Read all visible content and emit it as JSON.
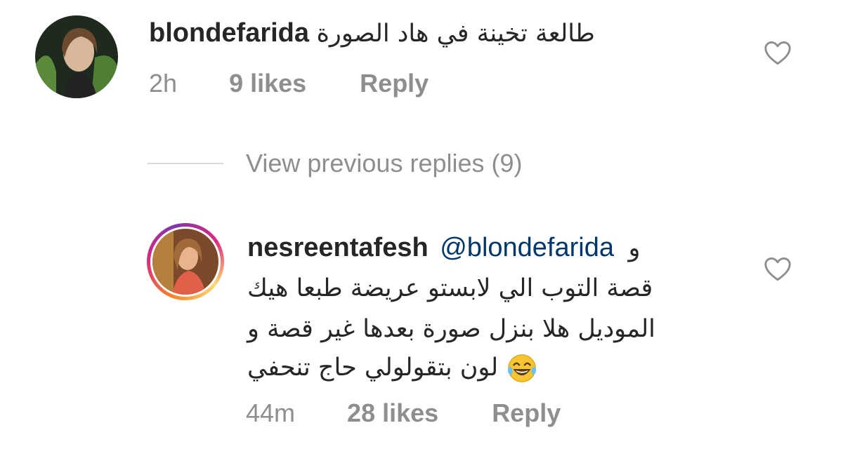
{
  "comment1": {
    "username": "blondefarida",
    "text": "طالعة تخينة في هاد الصورة",
    "time": "2h",
    "likes": "9 likes",
    "reply": "Reply"
  },
  "view_previous": "View previous replies (9)",
  "comment2": {
    "username": "nesreentafesh",
    "mention": "@blondefarida",
    "line1_tail": "و",
    "line2": "قصة التوب الي لابستو عريضة طبعا هيك",
    "line3": "الموديل هلا بنزل صورة بعدها غير قصة و",
    "line4": "لون بتقولولي حاج تنحفي",
    "emoji": "laughing-tears-emoji",
    "time": "44m",
    "likes": "28 likes",
    "reply": "Reply"
  },
  "icons": {
    "like": "heart-outline-icon"
  }
}
